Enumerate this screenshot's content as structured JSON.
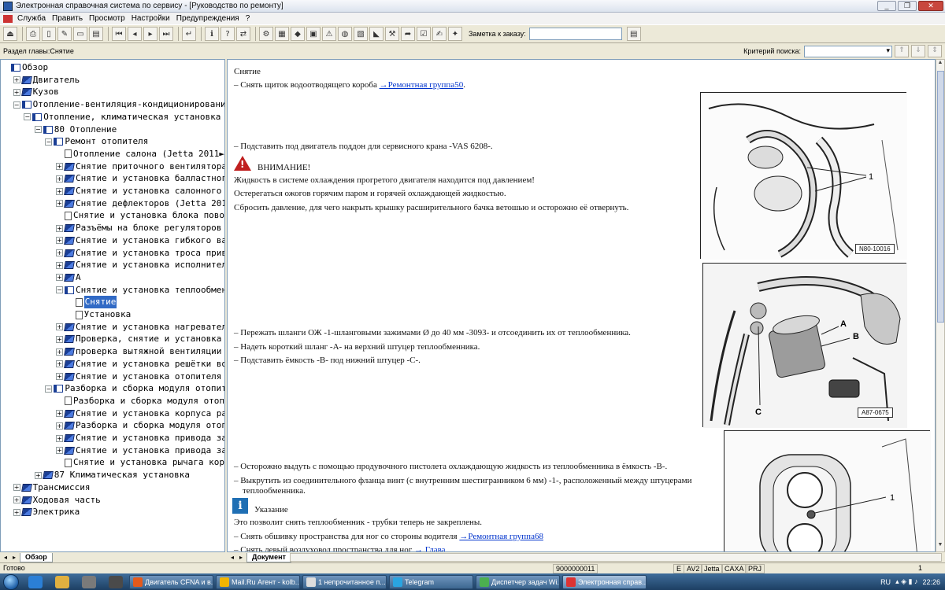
{
  "window": {
    "title": "Электронная справочная система по сервису - [Руководство по ремонту]",
    "controls": [
      "_",
      "❐",
      "✕"
    ]
  },
  "menu": [
    "Служба",
    "Править",
    "Просмотр",
    "Настройки",
    "Предупреждения",
    "?"
  ],
  "toolbar": {
    "order_label": "Заметка к заказу:",
    "order_value": ""
  },
  "chapter": {
    "label": "Раздел главы:Снятие",
    "search_label": "Критерий поиска:",
    "search_value": ""
  },
  "tree": [
    {
      "label": "Обзор",
      "indent": 0,
      "icon": "open",
      "exp": ""
    },
    {
      "label": "Двигатель",
      "indent": 1,
      "icon": "closed",
      "exp": "+"
    },
    {
      "label": "Кузов",
      "indent": 1,
      "icon": "closed",
      "exp": "+"
    },
    {
      "label": "Отопление-вентиляция-кондиционирование",
      "indent": 1,
      "icon": "open",
      "exp": "-"
    },
    {
      "label": "Отопление, климатическая установка",
      "indent": 2,
      "icon": "open",
      "exp": "-"
    },
    {
      "label": "80 Отопление",
      "indent": 3,
      "icon": "open",
      "exp": "-"
    },
    {
      "label": "Ремонт отопителя",
      "indent": 4,
      "icon": "open",
      "exp": "-"
    },
    {
      "label": "Отопление салона (Jetta 2011►",
      "indent": 5,
      "icon": "page",
      "exp": ""
    },
    {
      "label": "Снятие приточного вентилятора",
      "indent": 5,
      "icon": "closed",
      "exp": "+"
    },
    {
      "label": "Снятие и установка балластного",
      "indent": 5,
      "icon": "closed",
      "exp": "+"
    },
    {
      "label": "Снятие и установка салонного",
      "indent": 5,
      "icon": "closed",
      "exp": "+"
    },
    {
      "label": "Снятие дефлекторов (Jetta 201",
      "indent": 5,
      "icon": "closed",
      "exp": "+"
    },
    {
      "label": "Снятие и установка блока пово",
      "indent": 5,
      "icon": "page",
      "exp": ""
    },
    {
      "label": "Разъёмы на блоке регуляторов",
      "indent": 5,
      "icon": "closed",
      "exp": "+"
    },
    {
      "label": "Снятие и установка гибкого ва",
      "indent": 5,
      "icon": "closed",
      "exp": "+"
    },
    {
      "label": "Снятие и установка троса прив",
      "indent": 5,
      "icon": "closed",
      "exp": "+"
    },
    {
      "label": "Снятие и установка исполнител",
      "indent": 5,
      "icon": "closed",
      "exp": "+"
    },
    {
      "label": "А",
      "indent": 5,
      "icon": "closed",
      "exp": "+"
    },
    {
      "label": "Снятие и установка теплообмен",
      "indent": 5,
      "icon": "open",
      "exp": "-"
    },
    {
      "label": "Снятие",
      "indent": 6,
      "icon": "page",
      "exp": "",
      "selected": true
    },
    {
      "label": "Установка",
      "indent": 6,
      "icon": "page",
      "exp": ""
    },
    {
      "label": "Снятие и установка нагревател",
      "indent": 5,
      "icon": "closed",
      "exp": "+"
    },
    {
      "label": "Проверка, снятие и установка",
      "indent": 5,
      "icon": "closed",
      "exp": "+"
    },
    {
      "label": "проверка вытяжной вентиляции",
      "indent": 5,
      "icon": "closed",
      "exp": "+"
    },
    {
      "label": "Снятие и установка решётки во",
      "indent": 5,
      "icon": "closed",
      "exp": "+"
    },
    {
      "label": "Снятие и установка отопителя",
      "indent": 5,
      "icon": "closed",
      "exp": "+"
    },
    {
      "label": "Разборка и сборка модуля отопит",
      "indent": 4,
      "icon": "open",
      "exp": "-"
    },
    {
      "label": "Разборка и сборка модуля отоп",
      "indent": 5,
      "icon": "page",
      "exp": ""
    },
    {
      "label": "Снятие и установка корпуса ра",
      "indent": 5,
      "icon": "closed",
      "exp": "+"
    },
    {
      "label": "Разборка и сборка модуля отоп",
      "indent": 5,
      "icon": "closed",
      "exp": "+"
    },
    {
      "label": "Снятие и установка привода за",
      "indent": 5,
      "icon": "closed",
      "exp": "+"
    },
    {
      "label": "Снятие и установка привода за",
      "indent": 5,
      "icon": "closed",
      "exp": "+"
    },
    {
      "label": "Снятие и установка рычага кор",
      "indent": 5,
      "icon": "page",
      "exp": ""
    },
    {
      "label": "87 Климатическая установка",
      "indent": 3,
      "icon": "closed",
      "exp": "+"
    },
    {
      "label": "Трансмиссия",
      "indent": 1,
      "icon": "closed",
      "exp": "+"
    },
    {
      "label": "Ходовая часть",
      "indent": 1,
      "icon": "closed",
      "exp": "+"
    },
    {
      "label": "Электрика",
      "indent": 1,
      "icon": "closed",
      "exp": "+"
    }
  ],
  "tree_tab": "Обзор",
  "doc_tab": "Документ",
  "document": {
    "heading": "Снятие",
    "step1": "–  Снять щиток водоотводящего короба ",
    "step1_link": "→Ремонтная группа50",
    "step1_end": ".",
    "step2": "–  Подставить под двигатель поддон для сервисного крана -VAS 6208-.",
    "warning_title": "ВНИМАНИЕ!",
    "warning_lines": [
      "Жидкость в системе охлаждения прогретого двигателя находится под давлением!",
      "Остерегаться ожогов горячим паром и горячей охлаждающей жидкостью.",
      "Сбросить давление, для чего накрыть крышку расширительного бачка ветошью и осторожно её отвернуть."
    ],
    "step3": "–  Пережать шланги ОЖ -1-шланговыми зажимами Ø до 40 мм -3093- и отсоединить их от теплообменника.",
    "step4": "–  Надеть короткий шланг -A- на верхний штуцер теплообменника.",
    "step5": "–  Подставить ёмкость -B- под нижний штуцер -C-.",
    "step6": "–  Осторожно выдуть с помощью продувочного пистолета охлаждающую жидкость из теплообменника в ёмкость -B-.",
    "step7a": "–  Выкрутить из соединительного фланца винт (с внутренним шестигранником 6 мм) -1-, расположенный между штуцерами",
    "step7b": "теплообменника.",
    "note_title": "Указание",
    "note_text": "Это позволит снять теплообменник - трубки теперь не закреплены.",
    "step8": "–  Снять обшивку пространства для ног со стороны водителя ",
    "step8_link": "→Ремонтная группа68",
    "step9": "–  Снять левый воздуховод пространства для ног ",
    "step9_link": "→ Глава"
  },
  "figures": {
    "fig1_label": "N80-10016",
    "fig1_callout": "1",
    "fig2_label": "A87-0675",
    "fig2_callouts": [
      "A",
      "B",
      "C"
    ],
    "fig3_callout": "1"
  },
  "status": {
    "text": "Готово",
    "code": "9000000011",
    "cells": [
      "E",
      "AV2",
      "Jetta",
      "CAXA",
      "PRJ"
    ],
    "page": "1"
  },
  "taskbar": {
    "buttons": [
      "Двигатель CFNA и в...",
      "Mail.Ru Агент - kolb...",
      "1 непрочитанное п...",
      "Telegram",
      "Диспетчер задач Wi...",
      "Электронная справ..."
    ],
    "lang": "RU",
    "time": "22:26"
  }
}
